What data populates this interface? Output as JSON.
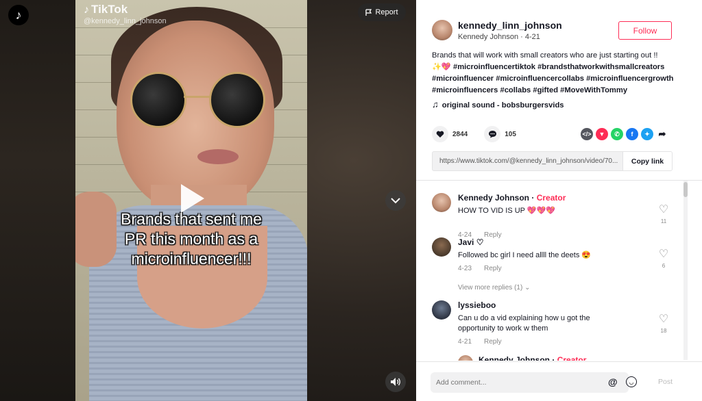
{
  "video": {
    "watermark_brand": "TikTok",
    "watermark_user": "@kennedy_linn_johnson",
    "caption_lines": [
      "Brands that sent me",
      "PR this month as a",
      "microinfluencer!!!"
    ],
    "report_label": "Report",
    "icons": [
      "tiktok-logo-icon",
      "play-icon",
      "flag-icon",
      "chevron-down-icon",
      "volume-icon"
    ]
  },
  "post": {
    "username": "kennedy_linn_johnson",
    "display_name": "Kennedy Johnson",
    "date": "4-21",
    "meta": "Kennedy Johnson · 4-21",
    "follow_label": "Follow",
    "description_text": "Brands that will work with small creators who are just starting out !!",
    "description_emoji": "✨💖",
    "hashtags_line1": "#microinfluencertiktok #brandsthatworkwithsmallcreators",
    "hashtags_line2": "#microinfluencer #microinfluencercollabs #microinfluencergrowth",
    "hashtags_line3": "#microinfluencers #collabs #gifted #MoveWithTommy",
    "sound": "original sound - bobsburgersvids",
    "likes": "2844",
    "comments_count": "105",
    "share_icons": [
      "embed-icon",
      "tiktok-share-icon",
      "whatsapp-icon",
      "facebook-icon",
      "twitter-icon",
      "share-arrow-icon"
    ],
    "link_url": "https://www.tiktok.com/@kennedy_linn_johnson/video/70...",
    "copy_link_label": "Copy link",
    "colors": {
      "accent": "#fe2c55",
      "text": "#161823",
      "muted": "#888888"
    }
  },
  "comments": [
    {
      "name": "Kennedy Johnson",
      "badge": "Creator",
      "sep": " · ",
      "text": "HOW TO VID IS UP 💖💖💖",
      "date": "4-24",
      "reply": "Reply",
      "likes": "11"
    },
    {
      "name": "Javi ♡",
      "text": "Followed bc girl I need allll the deets 😍",
      "date": "4-23",
      "reply": "Reply",
      "likes": "6"
    },
    {
      "name": "lyssieboo",
      "text": "Can u do a vid explaining how u got the opportunity to work w them",
      "date": "4-21",
      "reply": "Reply",
      "likes": "18"
    },
    {
      "name": "Kennedy Johnson",
      "badge": "Creator",
      "sep": " · "
    }
  ],
  "view_more": "View more replies (1)",
  "comment_bar": {
    "placeholder": "Add comment...",
    "at": "@",
    "post_label": "Post"
  }
}
